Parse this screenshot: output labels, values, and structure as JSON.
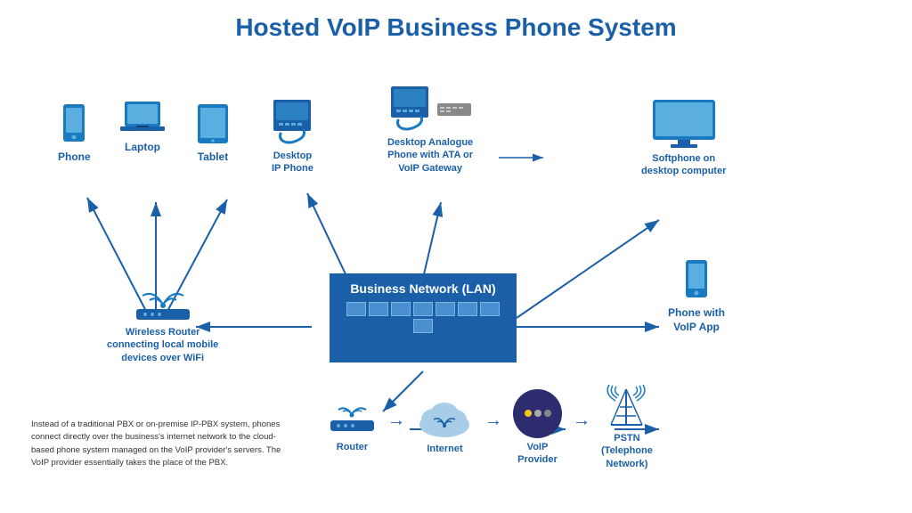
{
  "title": "Hosted VoIP Business Phone System",
  "devices": {
    "phone_label": "Phone",
    "laptop_label": "Laptop",
    "tablet_label": "Tablet",
    "desktop_ip_label": "Desktop\nIP Phone",
    "desktop_analogue_label": "Desktop Analogue\nPhone with ATA or\nVoIP Gateway",
    "softphone_label": "Softphone on\ndesktop computer",
    "voip_app_label": "Phone with\nVoIP App"
  },
  "network": {
    "label": "Business Network (LAN)"
  },
  "wireless_router_label": "Wireless Router\nconnecting local mobile\ndevices over WiFi",
  "bottom": {
    "router_label": "Router",
    "internet_label": "Internet",
    "voip_provider_label": "VoIP\nProvider",
    "pstn_label": "PSTN\n(Telephone\nNetwork)"
  },
  "info_text": "Instead of a traditional PBX or on-premise IP-PBX system, phones connect directly over the business's internet network to the cloud-based phone system managed on the VoIP provider's servers. The VoIP provider essentially takes the place of the PBX."
}
